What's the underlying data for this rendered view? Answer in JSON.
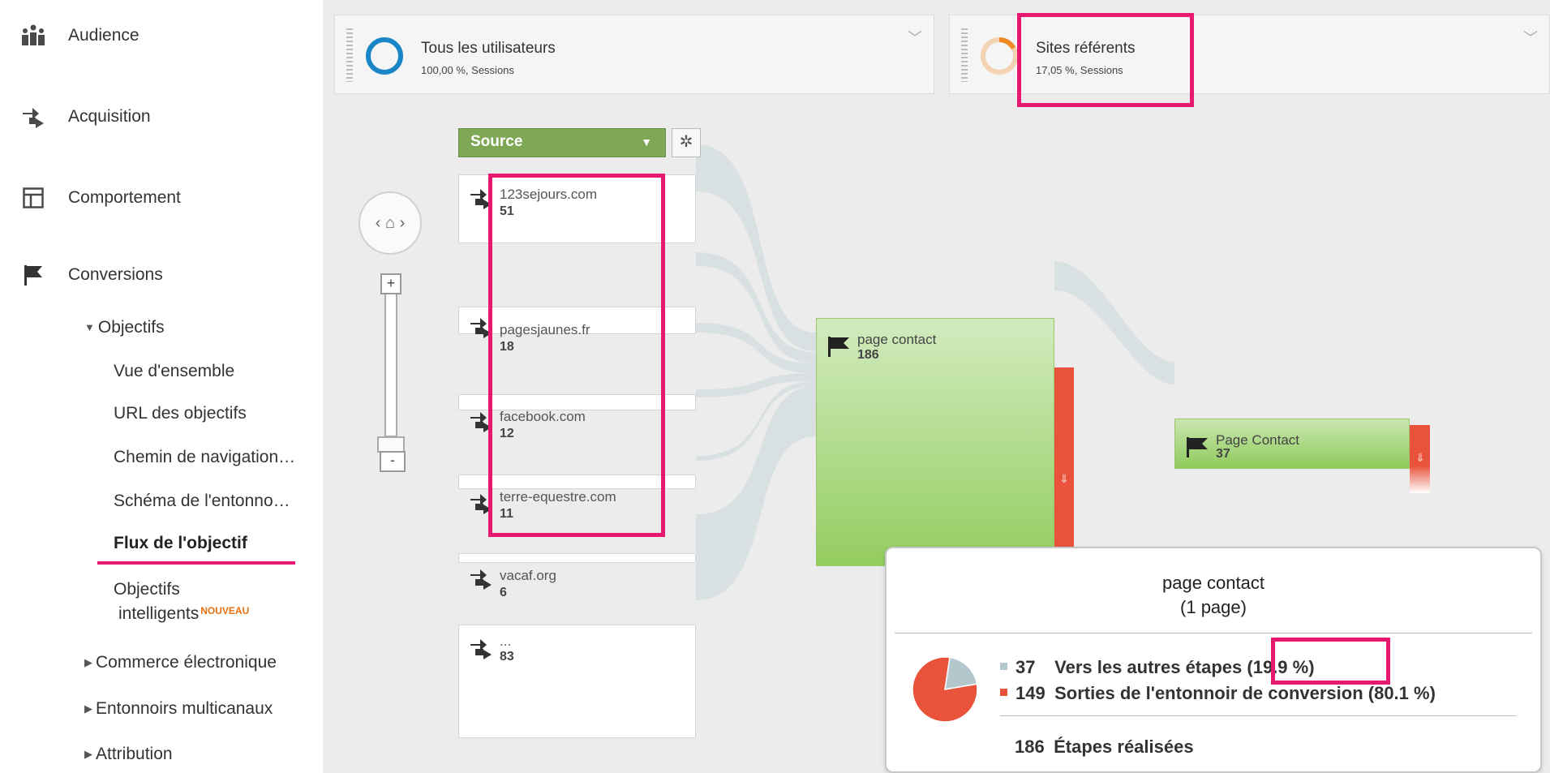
{
  "sidebar": {
    "top_items": [
      {
        "label": "Audience",
        "icon": "audience-icon"
      },
      {
        "label": "Acquisition",
        "icon": "acquisition-icon"
      },
      {
        "label": "Comportement",
        "icon": "behavior-icon"
      },
      {
        "label": "Conversions",
        "icon": "flag-icon"
      }
    ],
    "objectifs_label": "Objectifs",
    "objectifs_items": [
      "Vue d'ensemble",
      "URL des objectifs",
      "Chemin de navigation…",
      "Schéma de l'entonno…",
      "Flux de l'objectif"
    ],
    "smart_goals": {
      "line1": "Objectifs",
      "line2": "intelligents",
      "badge": "NOUVEAU"
    },
    "collapsed_items": [
      "Commerce électronique",
      "Entonnoirs multicanaux",
      "Attribution"
    ]
  },
  "segments": [
    {
      "title": "Tous les utilisateurs",
      "subtitle": "100,00 %, Sessions",
      "color": "#1a86c8",
      "share": 1.0
    },
    {
      "title": "Sites référents",
      "subtitle": "17,05 %, Sessions",
      "color": "#f08a24",
      "share": 0.1705
    }
  ],
  "flow": {
    "dimension_label": "Source",
    "sources": [
      {
        "name": "123sejours.com",
        "count": "51"
      },
      {
        "name": "pagesjaunes.fr",
        "count": "18"
      },
      {
        "name": "facebook.com",
        "count": "12"
      },
      {
        "name": "terre-equestre.com",
        "count": "11"
      },
      {
        "name": "vacaf.org",
        "count": "6"
      },
      {
        "name": "...",
        "count": "83"
      }
    ],
    "step1": {
      "name": "page contact",
      "count": "186"
    },
    "step2": {
      "name": "Page Contact",
      "count": "37"
    }
  },
  "tooltip": {
    "title_line1": "page contact",
    "title_line2": "(1 page)",
    "rows": [
      {
        "count": "37",
        "label": "Vers les autres étapes (19.9 %)",
        "color": "#b3c7cc",
        "fraction": 0.199
      },
      {
        "count": "149",
        "label": "Sorties de l'entonnoir de conversion (80.1 %)",
        "color": "#e9533c",
        "fraction": 0.801
      }
    ],
    "total_count": "186",
    "total_label": "Étapes réalisées"
  },
  "colors": {
    "highlight": "#e8176f",
    "goal_green": "#93cd60",
    "exit_red": "#e9533c",
    "flow_link": "#d6dfe1"
  }
}
